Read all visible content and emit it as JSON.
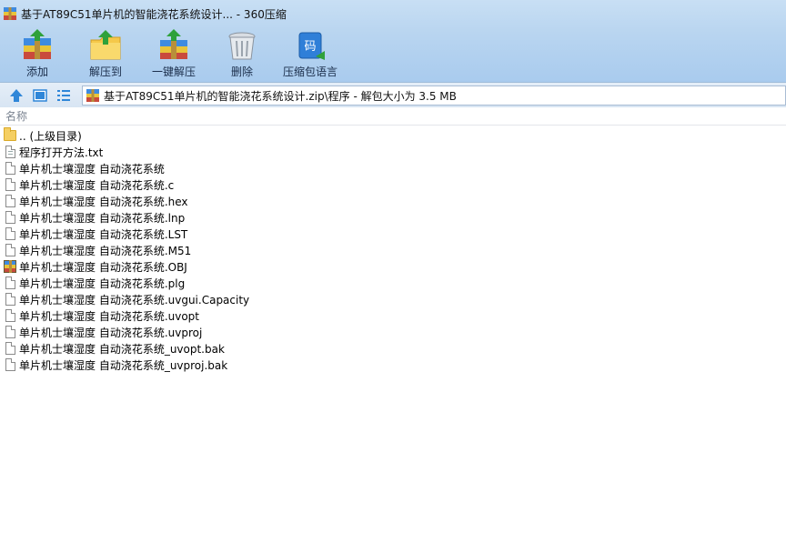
{
  "window": {
    "title": "基于AT89C51单片机的智能浇花系统设计... - 360压缩"
  },
  "toolbar": {
    "items": [
      {
        "label": "添加",
        "icon": "add-archive-icon"
      },
      {
        "label": "解压到",
        "icon": "extract-to-icon"
      },
      {
        "label": "一键解压",
        "icon": "one-click-extract-icon"
      },
      {
        "label": "删除",
        "icon": "delete-trash-icon"
      },
      {
        "label": "压缩包语言",
        "icon": "archive-language-icon"
      }
    ]
  },
  "address": {
    "path": "基于AT89C51单片机的智能浇花系统设计.zip\\程序 - 解包大小为 3.5 MB"
  },
  "list": {
    "column_name": "名称",
    "files": [
      {
        "name": ".. (上级目录)",
        "icon": "folder-icon"
      },
      {
        "name": "程序打开方法.txt",
        "icon": "text-file-icon"
      },
      {
        "name": "单片机士壤湿度  自动浇花系统",
        "icon": "file-icon"
      },
      {
        "name": "单片机士壤湿度  自动浇花系统.c",
        "icon": "file-icon"
      },
      {
        "name": "单片机士壤湿度  自动浇花系统.hex",
        "icon": "file-icon"
      },
      {
        "name": "单片机士壤湿度  自动浇花系统.lnp",
        "icon": "file-icon"
      },
      {
        "name": "单片机士壤湿度  自动浇花系统.LST",
        "icon": "file-icon"
      },
      {
        "name": "单片机士壤湿度  自动浇花系统.M51",
        "icon": "file-icon"
      },
      {
        "name": "单片机士壤湿度  自动浇花系统.OBJ",
        "icon": "archive-file-icon"
      },
      {
        "name": "单片机士壤湿度  自动浇花系统.plg",
        "icon": "file-icon"
      },
      {
        "name": "单片机士壤湿度  自动浇花系统.uvgui.Capacity",
        "icon": "file-icon"
      },
      {
        "name": "单片机士壤湿度  自动浇花系统.uvopt",
        "icon": "file-icon"
      },
      {
        "name": "单片机士壤湿度  自动浇花系统.uvproj",
        "icon": "file-icon"
      },
      {
        "name": "单片机士壤湿度  自动浇花系统_uvopt.bak",
        "icon": "file-icon"
      },
      {
        "name": "单片机士壤湿度  自动浇花系统_uvproj.bak",
        "icon": "file-icon"
      }
    ]
  }
}
